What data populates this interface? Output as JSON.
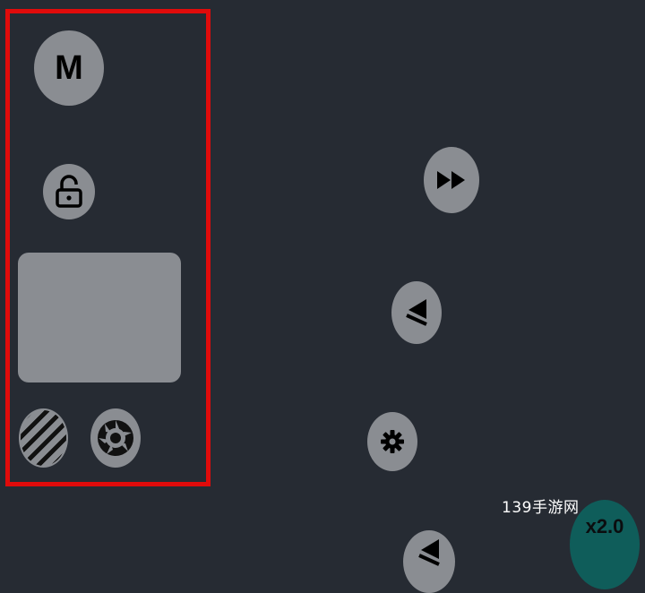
{
  "left_panel": {
    "mode_button_label": "M"
  },
  "speed": {
    "label": "x2.0"
  },
  "watermark": {
    "text": "139手游网"
  },
  "colors": {
    "background": "#262b33",
    "button_gray": "#8a8d92",
    "highlight_red": "#e00b0b",
    "speed_teal": "#0f5d5a"
  },
  "icons": {
    "lock": "unlock-icon",
    "stripes": "stripes-icon",
    "aperture": "aperture-icon",
    "fast_forward": "fast-forward-icon",
    "eject": "rewind-icon",
    "gear": "gear-icon"
  }
}
